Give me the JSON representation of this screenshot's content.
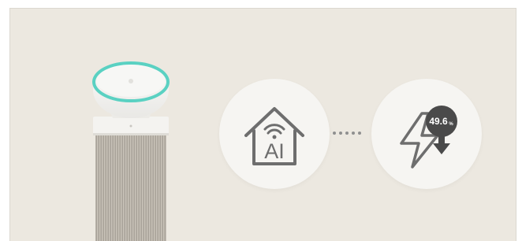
{
  "ai_icon": {
    "label": "AI",
    "icon": "smart-home-wifi-icon"
  },
  "energy_icon": {
    "percent": "49.6",
    "unit": "%",
    "icon": "lightning-bolt-down-arrow-icon"
  },
  "colors": {
    "background": "#ece8e0",
    "circle": "#f6f5f2",
    "icon_gray": "#6e6e6e",
    "badge_dark": "#4a4a4a",
    "accent_teal": "#5ad1c2"
  }
}
